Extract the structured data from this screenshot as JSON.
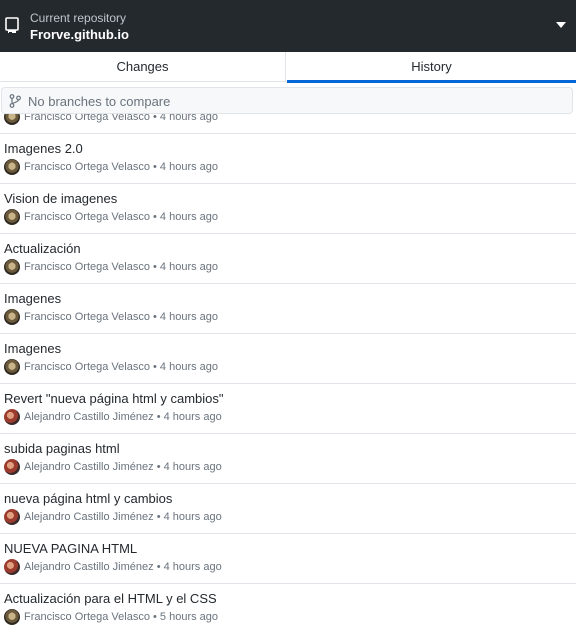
{
  "repository": {
    "label": "Current repository",
    "name": "Frorve.github.io"
  },
  "tabs": [
    {
      "label": "Changes"
    },
    {
      "label": "History"
    }
  ],
  "compare": {
    "placeholder": "No branches to compare"
  },
  "commits": [
    {
      "title": "",
      "author": "Francisco Ortega Velasco",
      "time": "• 4 hours ago"
    },
    {
      "title": "Imagenes 2.0",
      "author": "Francisco Ortega Velasco",
      "time": "• 4 hours ago"
    },
    {
      "title": "Vision de imagenes",
      "author": "Francisco Ortega Velasco",
      "time": "• 4 hours ago"
    },
    {
      "title": "Actualización",
      "author": "Francisco Ortega Velasco",
      "time": "• 4 hours ago"
    },
    {
      "title": "Imagenes",
      "author": "Francisco Ortega Velasco",
      "time": "• 4 hours ago"
    },
    {
      "title": "Imagenes",
      "author": "Francisco Ortega Velasco",
      "time": "• 4 hours ago"
    },
    {
      "title": "Revert \"nueva página html y cambios\"",
      "author": "Alejandro Castillo Jiménez",
      "time": "• 4 hours ago"
    },
    {
      "title": "subida paginas html",
      "author": "Alejandro Castillo Jiménez",
      "time": "• 4 hours ago"
    },
    {
      "title": "nueva página html y cambios",
      "author": "Alejandro Castillo Jiménez",
      "time": "• 4 hours ago"
    },
    {
      "title": "NUEVA PAGINA HTML",
      "author": "Alejandro Castillo Jiménez",
      "time": "• 4 hours ago"
    },
    {
      "title": "Actualización para el HTML y el CSS",
      "author": "Francisco Ortega Velasco",
      "time": "• 5 hours ago"
    }
  ]
}
